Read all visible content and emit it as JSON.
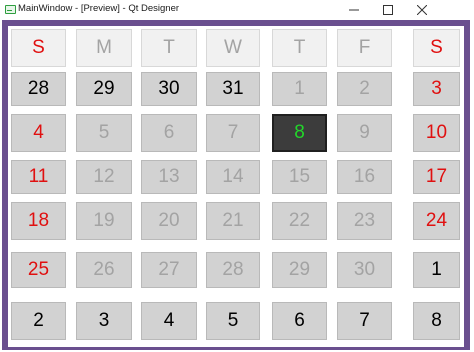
{
  "window": {
    "title": "MainWindow - [Preview] - Qt Designer",
    "minimize_icon": "minimize-icon",
    "maximize_icon": "maximize-icon",
    "close_icon": "close-icon"
  },
  "colors": {
    "frame": "#6a4f8f",
    "weekend_text": "#e01010",
    "muted_text": "#a3a3a3",
    "today_background": "#3c3c3c",
    "today_text": "#22d62a"
  },
  "calendar": {
    "weekdays": [
      "S",
      "M",
      "T",
      "W",
      "T",
      "F",
      "S"
    ],
    "weeks": [
      [
        {
          "day": "28",
          "kind": "normal"
        },
        {
          "day": "29",
          "kind": "normal"
        },
        {
          "day": "30",
          "kind": "normal"
        },
        {
          "day": "31",
          "kind": "normal"
        },
        {
          "day": "1",
          "kind": "muted"
        },
        {
          "day": "2",
          "kind": "muted"
        },
        {
          "day": "3",
          "kind": "weekend"
        }
      ],
      [
        {
          "day": "4",
          "kind": "weekend"
        },
        {
          "day": "5",
          "kind": "muted"
        },
        {
          "day": "6",
          "kind": "muted"
        },
        {
          "day": "7",
          "kind": "muted"
        },
        {
          "day": "8",
          "kind": "today"
        },
        {
          "day": "9",
          "kind": "muted"
        },
        {
          "day": "10",
          "kind": "weekend"
        }
      ],
      [
        {
          "day": "11",
          "kind": "weekend"
        },
        {
          "day": "12",
          "kind": "muted"
        },
        {
          "day": "13",
          "kind": "muted"
        },
        {
          "day": "14",
          "kind": "muted"
        },
        {
          "day": "15",
          "kind": "muted"
        },
        {
          "day": "16",
          "kind": "muted"
        },
        {
          "day": "17",
          "kind": "weekend"
        }
      ],
      [
        {
          "day": "18",
          "kind": "weekend"
        },
        {
          "day": "19",
          "kind": "muted"
        },
        {
          "day": "20",
          "kind": "muted"
        },
        {
          "day": "21",
          "kind": "muted"
        },
        {
          "day": "22",
          "kind": "muted"
        },
        {
          "day": "23",
          "kind": "muted"
        },
        {
          "day": "24",
          "kind": "weekend"
        }
      ],
      [
        {
          "day": "25",
          "kind": "weekend"
        },
        {
          "day": "26",
          "kind": "muted"
        },
        {
          "day": "27",
          "kind": "muted"
        },
        {
          "day": "28",
          "kind": "muted"
        },
        {
          "day": "29",
          "kind": "muted"
        },
        {
          "day": "30",
          "kind": "muted"
        },
        {
          "day": "1",
          "kind": "normal"
        }
      ],
      [
        {
          "day": "2",
          "kind": "normal"
        },
        {
          "day": "3",
          "kind": "normal"
        },
        {
          "day": "4",
          "kind": "normal"
        },
        {
          "day": "5",
          "kind": "normal"
        },
        {
          "day": "6",
          "kind": "normal"
        },
        {
          "day": "7",
          "kind": "normal"
        },
        {
          "day": "8",
          "kind": "normal"
        }
      ]
    ]
  }
}
